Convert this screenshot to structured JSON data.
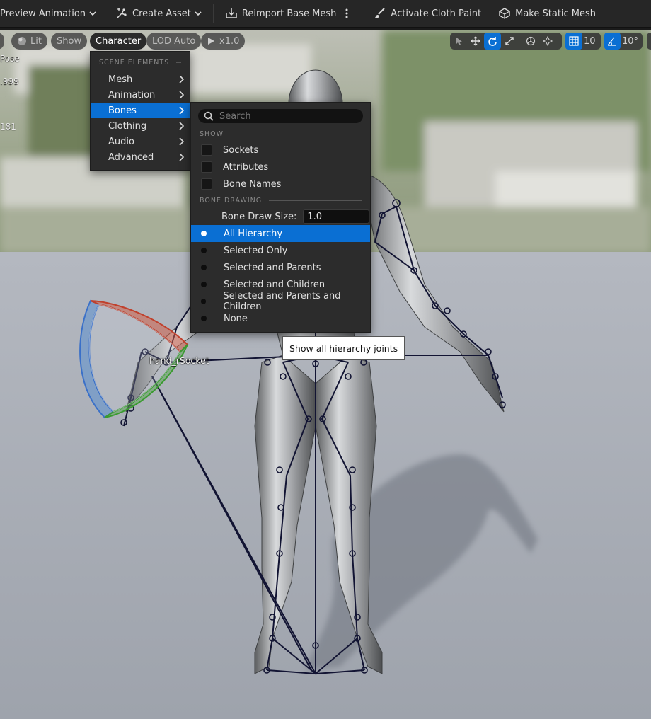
{
  "toolbar": {
    "preview_animation": "Preview Animation",
    "create_asset": "Create Asset",
    "reimport": "Reimport Base Mesh",
    "cloth_paint": "Activate Cloth Paint",
    "static_mesh": "Make Static Mesh"
  },
  "viewport": {
    "chips": {
      "lit": "Lit",
      "show": "Show",
      "character": "Character",
      "lod": "LOD Auto",
      "speed": "x1.0"
    },
    "grid_snap": "10",
    "angle_snap": "10°",
    "stats": [
      "Pose",
      ".999",
      "181"
    ],
    "socket_label": "hand_rSocket"
  },
  "character_menu": {
    "header": "SCENE ELEMENTS",
    "items": [
      {
        "label": "Mesh"
      },
      {
        "label": "Animation"
      },
      {
        "label": "Bones"
      },
      {
        "label": "Clothing"
      },
      {
        "label": "Audio"
      },
      {
        "label": "Advanced"
      }
    ]
  },
  "bones_menu": {
    "search_placeholder": "Search",
    "show_header": "SHOW",
    "show_items": [
      "Sockets",
      "Attributes",
      "Bone Names"
    ],
    "drawing_header": "BONE DRAWING",
    "draw_size_label": "Bone Draw Size:",
    "draw_size_value": "1.0",
    "options": [
      "All Hierarchy",
      "Selected Only",
      "Selected and Parents",
      "Selected and Children",
      "Selected and Parents and Children",
      "None"
    ],
    "selected_option": "All Hierarchy"
  },
  "tooltip": "Show all hierarchy joints",
  "colors": {
    "accent": "#0a6fd3",
    "menu_bg": "#2c2c2c",
    "toolbar_bg": "#262626"
  }
}
